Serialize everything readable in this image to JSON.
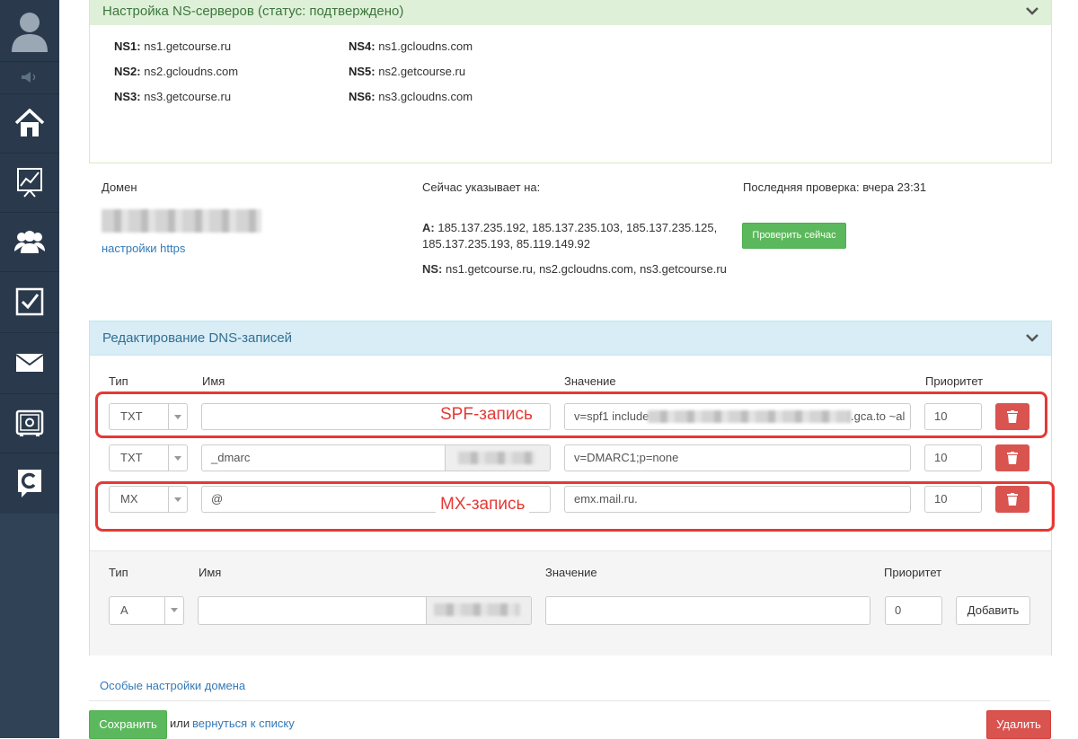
{
  "sidebar": {
    "items": [
      {
        "icon": "user-avatar-icon"
      },
      {
        "icon": "speaker-icon"
      },
      {
        "icon": "home-icon"
      },
      {
        "icon": "chart-icon"
      },
      {
        "icon": "users-icon"
      },
      {
        "icon": "checkbox-icon"
      },
      {
        "icon": "mail-icon"
      },
      {
        "icon": "safe-icon"
      },
      {
        "icon": "getcourse-logo-icon"
      }
    ]
  },
  "ns_panel": {
    "title": "Настройка NS-серверов (статус: подтверждено)",
    "servers": [
      {
        "label": "NS1:",
        "value": "ns1.getcourse.ru"
      },
      {
        "label": "NS2:",
        "value": "ns2.gcloudns.com"
      },
      {
        "label": "NS3:",
        "value": "ns3.getcourse.ru"
      },
      {
        "label": "NS4:",
        "value": "ns1.gcloudns.com"
      },
      {
        "label": "NS5:",
        "value": "ns2.getcourse.ru"
      },
      {
        "label": "NS6:",
        "value": "ns3.gcloudns.com"
      }
    ]
  },
  "domain": {
    "label": "Домен",
    "https_link": "настройки https",
    "points_label": "Сейчас указывает на:",
    "a_label": "A:",
    "a_value_line1": "185.137.235.192, 185.137.235.103, 185.137.235.125,",
    "a_value_line2": "185.137.235.193, 85.119.149.92",
    "ns_label": "NS:",
    "ns_value": "ns1.getcourse.ru, ns2.gcloudns.com, ns3.getcourse.ru",
    "last_check": "Последняя проверка: вчера 23:31",
    "check_now_button": "Проверить сейчас"
  },
  "dns_panel": {
    "title": "Редактирование DNS-записей",
    "columns": {
      "type": "Тип",
      "name": "Имя",
      "value": "Значение",
      "priority": "Приоритет"
    },
    "records": [
      {
        "type": "TXT",
        "name": "",
        "value_prefix": "v=spf1 include:",
        "value_suffix": ".gca.to ~al",
        "priority": "10"
      },
      {
        "type": "TXT",
        "name": "_dmarc",
        "value": "v=DMARC1;p=none",
        "priority": "10"
      },
      {
        "type": "MX",
        "name": "@",
        "value": "emx.mail.ru.",
        "priority": "10"
      }
    ],
    "annotations": {
      "spf": "SPF-запись",
      "mx": "MX-запись"
    },
    "annotation_color": "#e53935",
    "new_record": {
      "columns": {
        "type": "Тип",
        "name": "Имя",
        "value": "Значение",
        "priority": "Приоритет"
      },
      "type": "A",
      "name": "",
      "value": "",
      "priority": "0",
      "add_button": "Добавить"
    }
  },
  "footer": {
    "special_settings_link": "Особые настройки домена",
    "save_button": "Сохранить",
    "or_text": "или",
    "back_link": "вернуться к списку",
    "delete_button": "Удалить"
  },
  "colors": {
    "sidebar": "#2a3a4c",
    "success": "#5cb85c",
    "danger": "#d9534f",
    "link": "#337ab7"
  }
}
